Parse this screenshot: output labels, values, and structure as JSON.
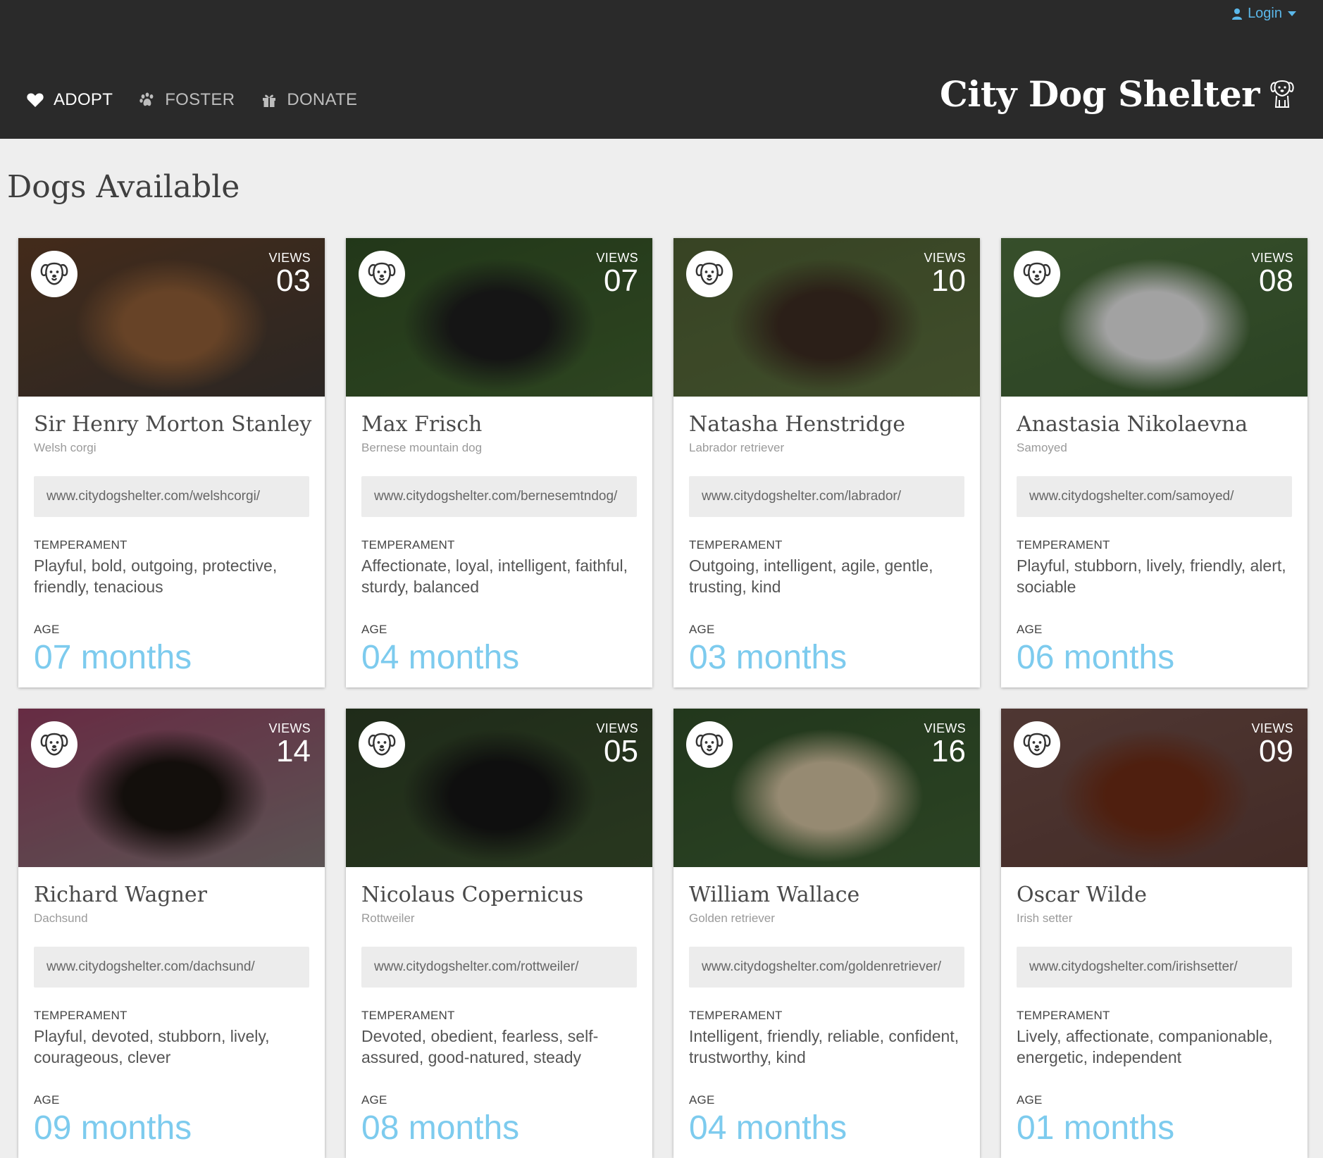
{
  "header": {
    "login_label": "Login",
    "brand_title": "City Dog Shelter",
    "nav": [
      {
        "label": "ADOPT",
        "icon": "heart-icon",
        "active": true
      },
      {
        "label": "FOSTER",
        "icon": "paw-icon",
        "active": false
      },
      {
        "label": "DONATE",
        "icon": "gift-icon",
        "active": false
      }
    ]
  },
  "main": {
    "title": "Dogs Available",
    "views_label": "VIEWS",
    "temperament_label": "TEMPERAMENT",
    "age_label": "AGE"
  },
  "dogs": [
    {
      "name": "Sir Henry Morton Stanley",
      "breed": "Welsh corgi",
      "url": "www.citydogshelter.com/welshcorgi/",
      "temperament": "Playful, bold, outgoing, protective, friendly, tenacious",
      "age": "07 months",
      "views": "03",
      "photo_colors": [
        "#5a3a24",
        "#8a5a34",
        "#3a3430"
      ]
    },
    {
      "name": "Max Frisch",
      "breed": "Bernese mountain dog",
      "url": "www.citydogshelter.com/bernesemtndog/",
      "temperament": "Affectionate, loyal, intelligent, faithful, sturdy, balanced",
      "age": "04 months",
      "views": "07",
      "photo_colors": [
        "#2e4a22",
        "#1c1c1c",
        "#3d5c2c"
      ]
    },
    {
      "name": "Natasha Henstridge",
      "breed": "Labrador retriever",
      "url": "www.citydogshelter.com/labrador/",
      "temperament": "Outgoing, intelligent, agile, gentle, trusting, kind",
      "age": "03 months",
      "views": "10",
      "photo_colors": [
        "#4a5a30",
        "#3a2a20",
        "#56683a"
      ]
    },
    {
      "name": "Anastasia Nikolaevna",
      "breed": "Samoyed",
      "url": "www.citydogshelter.com/samoyed/",
      "temperament": "Playful, stubborn, lively, friendly, alert, sociable",
      "age": "06 months",
      "views": "08",
      "photo_colors": [
        "#4a6a3a",
        "#d8d8d8",
        "#3a5a30"
      ]
    },
    {
      "name": "Richard Wagner",
      "breed": "Dachsund",
      "url": "www.citydogshelter.com/dachsund/",
      "temperament": "Playful, devoted, stubborn, lively, courageous, clever",
      "age": "09 months",
      "views": "14",
      "photo_colors": [
        "#8a3a5a",
        "#1a1410",
        "#7a7070"
      ]
    },
    {
      "name": "Nicolaus Copernicus",
      "breed": "Rottweiler",
      "url": "www.citydogshelter.com/rottweiler/",
      "temperament": "Devoted, obedient, fearless, self-assured, good-natured, steady",
      "age": "08 months",
      "views": "05",
      "photo_colors": [
        "#2a3a22",
        "#141414",
        "#364a2a"
      ]
    },
    {
      "name": "William Wallace",
      "breed": "Golden retriever",
      "url": "www.citydogshelter.com/goldenretriever/",
      "temperament": "Intelligent, friendly, reliable, confident, trustworthy, kind",
      "age": "04 months",
      "views": "16",
      "photo_colors": [
        "#2e4a26",
        "#c8b898",
        "#3a5a30"
      ]
    },
    {
      "name": "Oscar Wilde",
      "breed": "Irish setter",
      "url": "www.citydogshelter.com/irishsetter/",
      "temperament": "Lively, affectionate, companionable, energetic, independent",
      "age": "01 months",
      "views": "09",
      "photo_colors": [
        "#6a4a44",
        "#6a2a14",
        "#5a3a34"
      ]
    }
  ]
}
